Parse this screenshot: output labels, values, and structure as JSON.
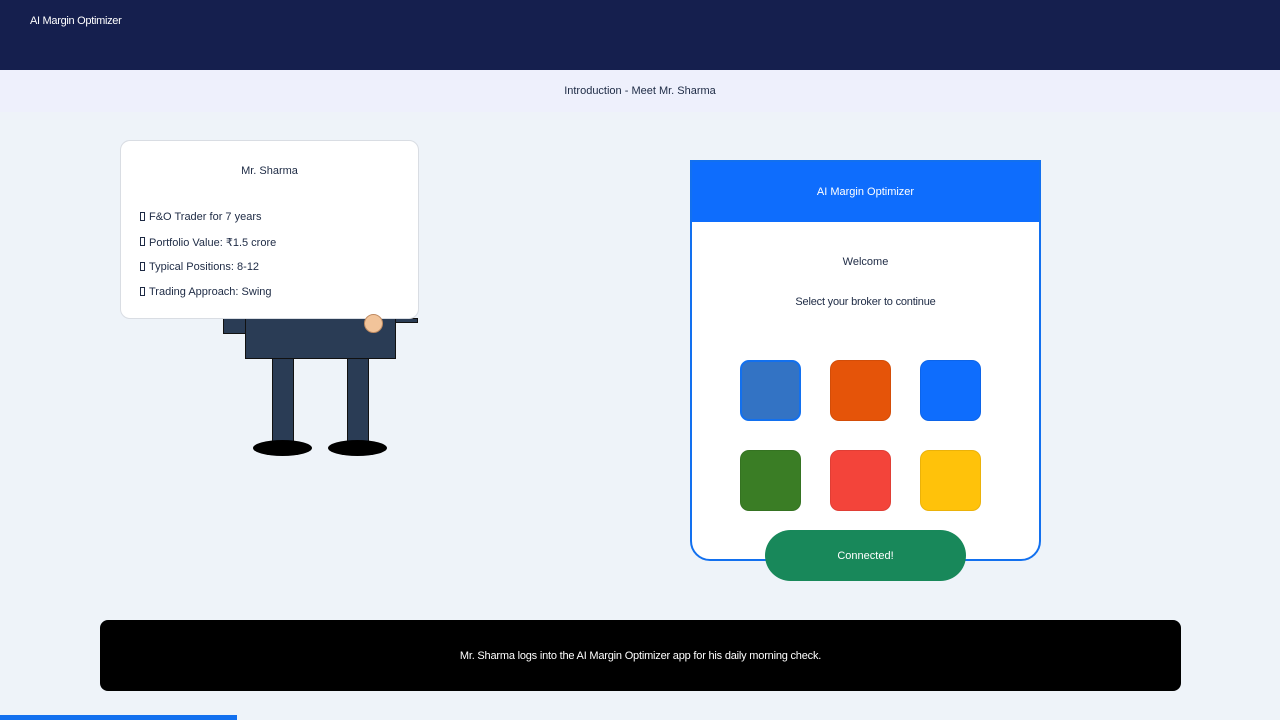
{
  "app": {
    "title": "AI Margin Optimizer"
  },
  "scene": {
    "title": "Introduction - Meet Mr. Sharma"
  },
  "profile": {
    "name": "Mr. Sharma",
    "items": [
      "F&O Trader for 7 years",
      "Portfolio Value: ₹1.5 crore",
      "Typical Positions: 8-12",
      "Trading Approach: Swing"
    ]
  },
  "phone": {
    "header": "AI Margin Optimizer",
    "welcome": "Welcome",
    "prompt": "Select your broker to continue",
    "brokers": [
      {
        "color": "#3373c4",
        "selected": true
      },
      {
        "color": "#e55409"
      },
      {
        "color": "#0e6dfd"
      },
      {
        "color": "#3a7d25"
      },
      {
        "color": "#f3443a"
      },
      {
        "color": "#ffc20a"
      }
    ],
    "status": "Connected!"
  },
  "caption": "Mr. Sharma logs into the AI Margin Optimizer app for his daily morning check.",
  "progress": {
    "fraction": 0.185,
    "color": "#1270ef"
  },
  "colors": {
    "topbar": "#151f4e",
    "accent": "#0e6dfd",
    "success": "#18885a"
  }
}
